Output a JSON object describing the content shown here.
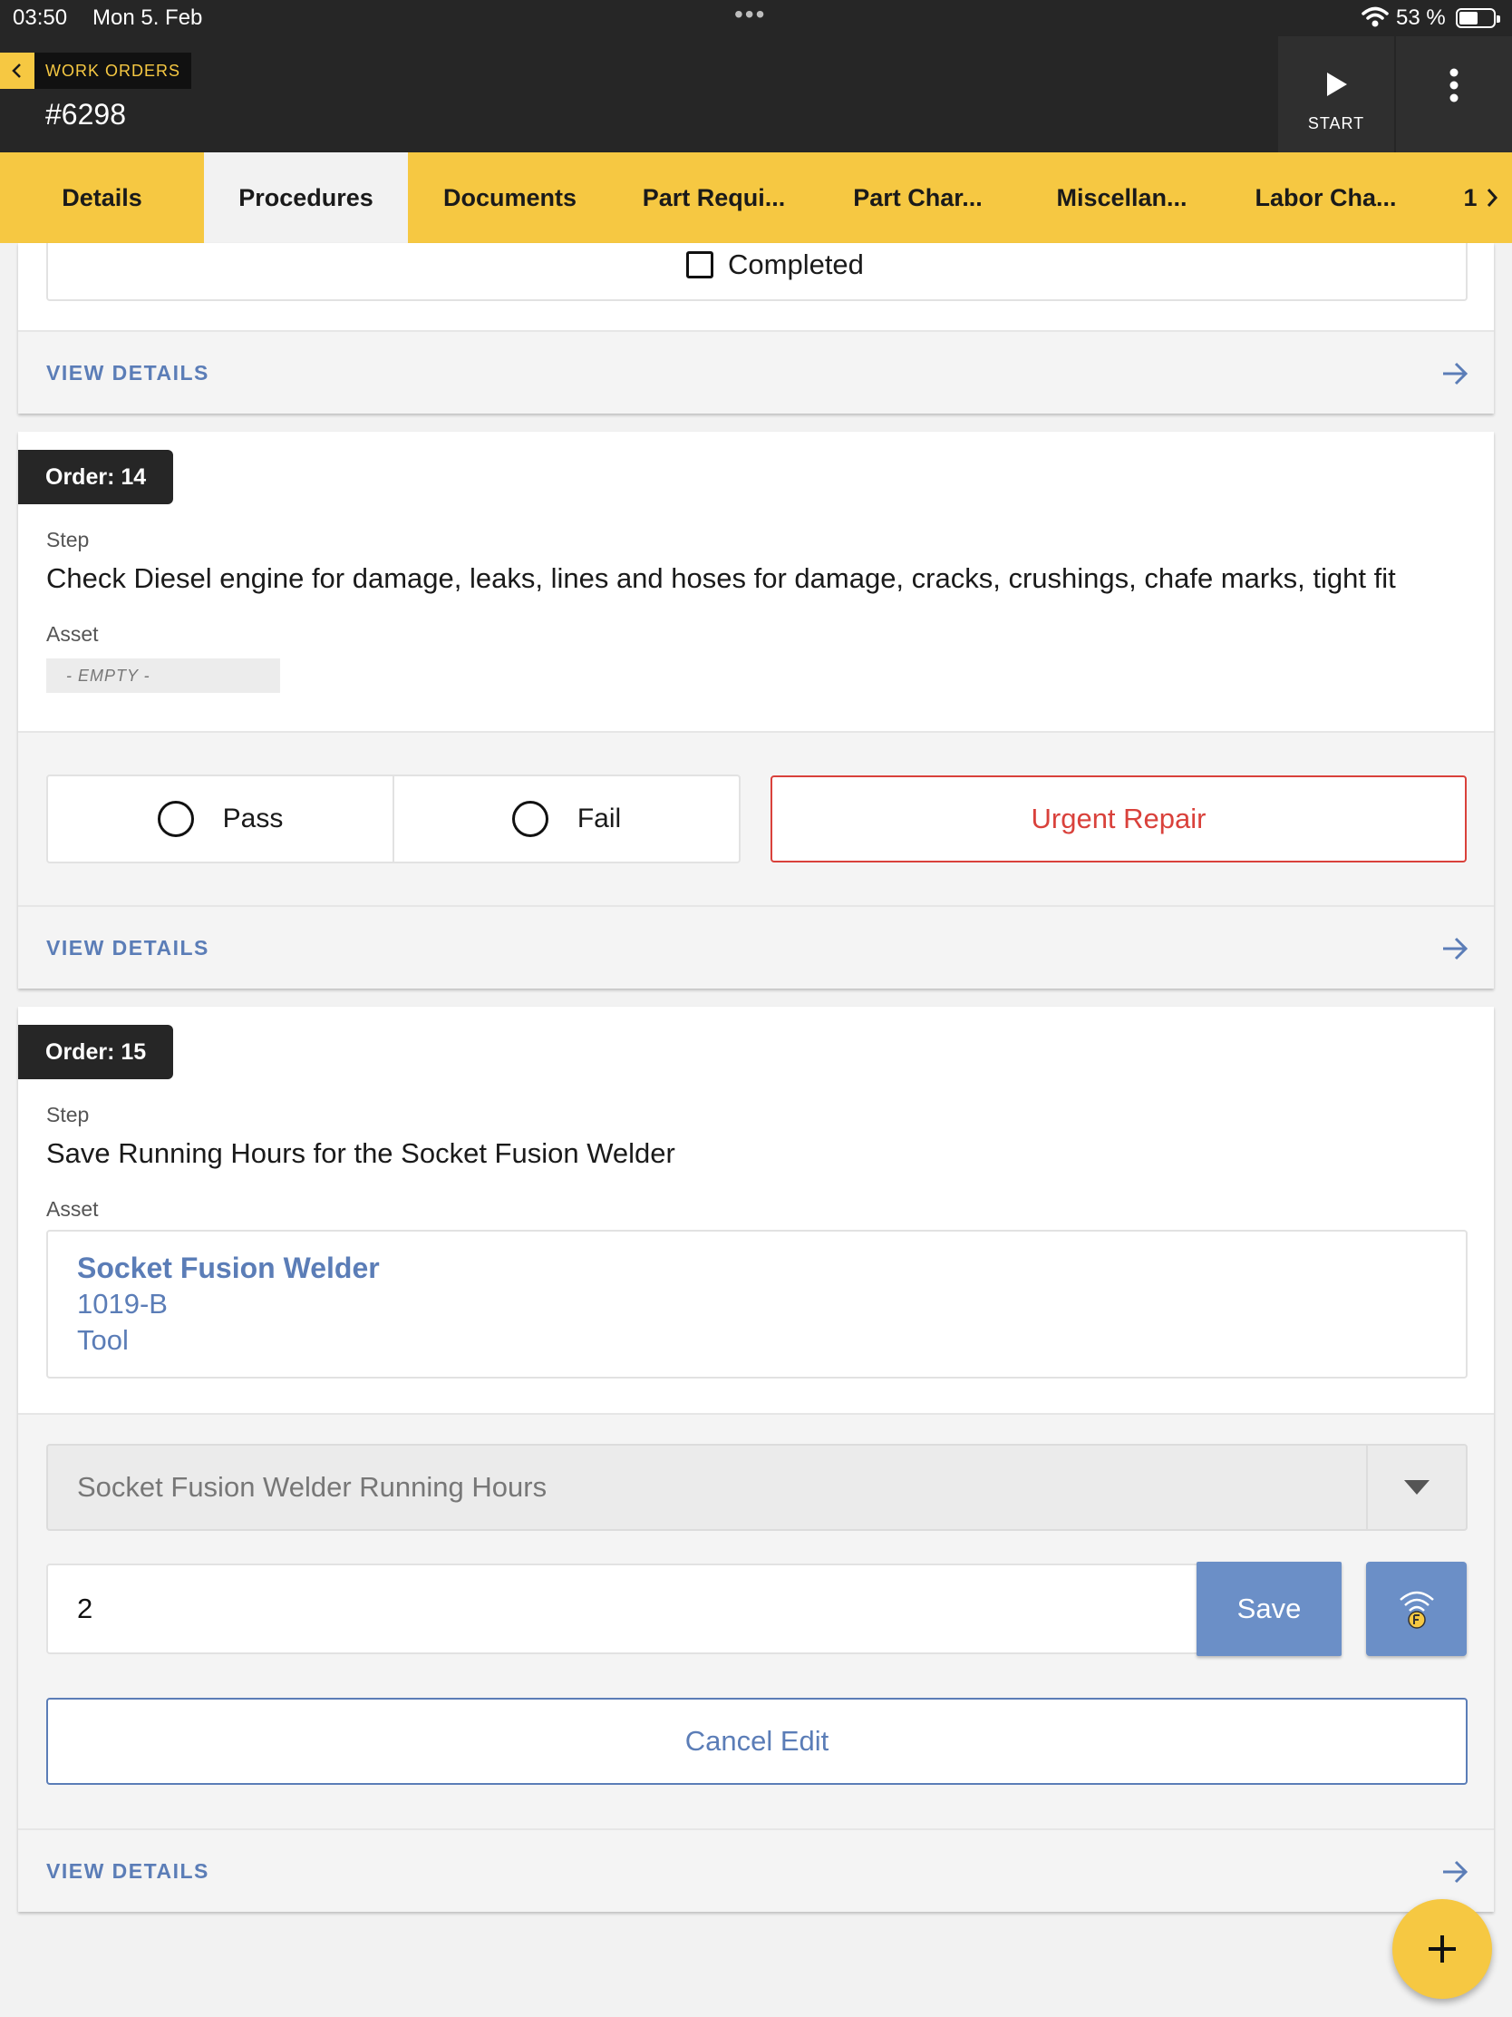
{
  "status_bar": {
    "time": "03:50",
    "date": "Mon 5. Feb",
    "battery": "53 %"
  },
  "header": {
    "back_label": "WORK ORDERS",
    "work_order_number": "#6298",
    "start_label": "START"
  },
  "tabs": [
    {
      "label": "Details"
    },
    {
      "label": "Procedures"
    },
    {
      "label": "Documents"
    },
    {
      "label": "Part Requi..."
    },
    {
      "label": "Part Char..."
    },
    {
      "label": "Miscellan..."
    },
    {
      "label": "Labor Cha..."
    }
  ],
  "tab_more": "1",
  "card_prev": {
    "completed_label": "Completed",
    "view_details": "VIEW DETAILS"
  },
  "card_14": {
    "order": "Order: 14",
    "step_label": "Step",
    "step_text": "Check Diesel engine for damage, leaks, lines and hoses for damage, cracks, crushings, chafe marks, tight fit",
    "asset_label": "Asset",
    "asset_empty": "- EMPTY -",
    "pass_label": "Pass",
    "fail_label": "Fail",
    "urgent_label": "Urgent Repair",
    "view_details": "VIEW DETAILS"
  },
  "card_15": {
    "order": "Order: 15",
    "step_label": "Step",
    "step_text": "Save Running Hours for the Socket Fusion Welder",
    "asset_label": "Asset",
    "asset_name": "Socket Fusion Welder",
    "asset_code": "1019-B",
    "asset_type": "Tool",
    "meter_select": "Socket Fusion Welder Running Hours",
    "meter_value": "2",
    "save_label": "Save",
    "cancel_label": "Cancel Edit",
    "view_details": "VIEW DETAILS"
  },
  "colors": {
    "accent_yellow": "#f6c842",
    "header_dark": "#262626",
    "link_blue": "#5b7db7",
    "button_blue": "#6b8fc7",
    "danger_red": "#d9413b"
  }
}
